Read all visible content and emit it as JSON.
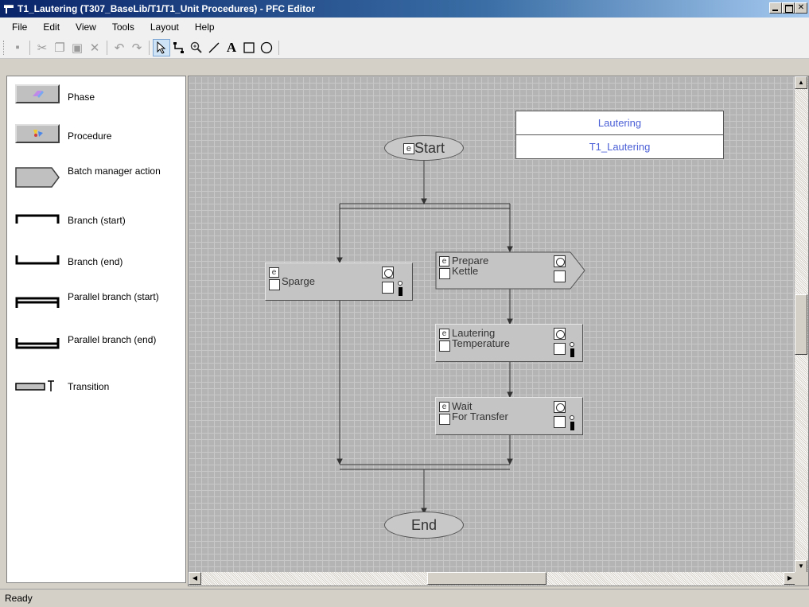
{
  "window": {
    "title": "T1_Lautering (T307_BaseLib/T1/T1_Unit Procedures) - PFC Editor"
  },
  "menu": [
    "File",
    "Edit",
    "View",
    "Tools",
    "Layout",
    "Help"
  ],
  "toolbar": {
    "icons": [
      "save-icon",
      "cut-icon",
      "copy-icon",
      "paste-icon",
      "delete-icon",
      "undo-icon",
      "redo-icon",
      "pointer-icon",
      "connector-icon",
      "zoom-icon",
      "line-icon",
      "text-icon",
      "rectangle-icon",
      "ellipse-icon"
    ],
    "text_tool": "A"
  },
  "palette": [
    {
      "label": "Phase",
      "icon": "phase-icon"
    },
    {
      "label": "Procedure",
      "icon": "procedure-icon"
    },
    {
      "label": "Batch manager action",
      "icon": "batch-manager-action-icon"
    },
    {
      "label": "Branch (start)",
      "icon": "branch-start-icon"
    },
    {
      "label": "Branch (end)",
      "icon": "branch-end-icon"
    },
    {
      "label": "Parallel branch (start)",
      "icon": "parallel-branch-start-icon"
    },
    {
      "label": "Parallel branch (end)",
      "icon": "parallel-branch-end-icon"
    },
    {
      "label": "Transition",
      "icon": "transition-icon"
    }
  ],
  "diagram": {
    "header": {
      "name": "Lautering",
      "id": "T1_Lautering"
    },
    "start": "Start",
    "end": "End",
    "steps": {
      "sparge": "Sparge",
      "prepare_kettle_1": "Prepare",
      "prepare_kettle_2": "Kettle",
      "lautering_temperature_1": "Lautering",
      "lautering_temperature_2": "Temperature",
      "wait_for_transfer_1": "Wait",
      "wait_for_transfer_2": "For Transfer"
    },
    "step_icon_glyph": "e"
  },
  "status": {
    "text": "Ready"
  }
}
